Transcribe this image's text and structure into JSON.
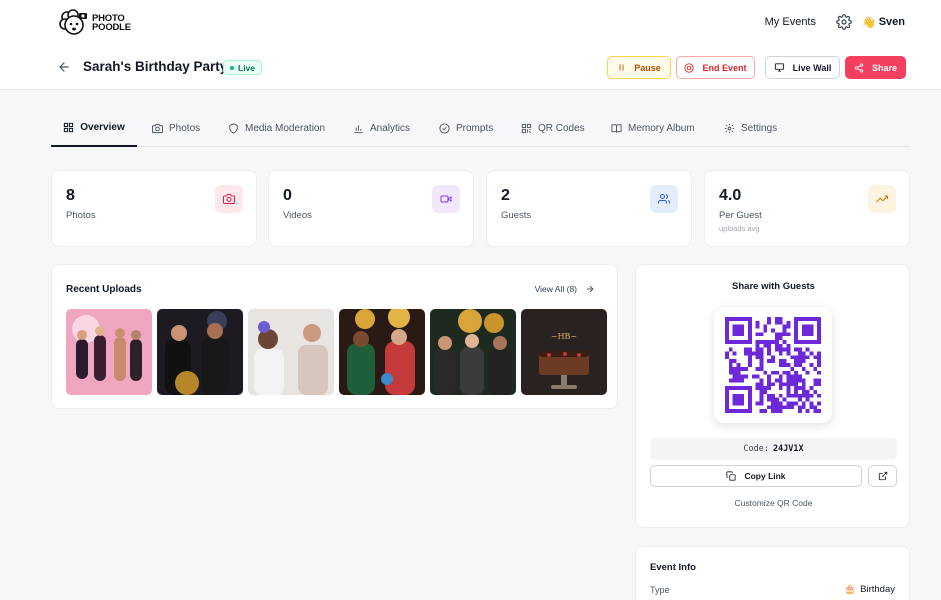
{
  "nav": {
    "logo_line1": "PHOTO",
    "logo_line2": "POODLE",
    "my_events": "My Events",
    "user_emoji": "👋",
    "user_name": "Sven"
  },
  "event": {
    "title": "Sarah's Birthday Party!",
    "status": "Live",
    "buttons": {
      "pause": "Pause",
      "end": "End Event",
      "live_wall": "Live Wall",
      "share": "Share"
    }
  },
  "tabs": [
    {
      "label": "Overview",
      "icon": "grid-icon",
      "active": true
    },
    {
      "label": "Photos",
      "icon": "camera-icon"
    },
    {
      "label": "Media Moderation",
      "icon": "shield-icon"
    },
    {
      "label": "Analytics",
      "icon": "bar-chart-icon"
    },
    {
      "label": "Prompts",
      "icon": "check-circle-icon"
    },
    {
      "label": "QR Codes",
      "icon": "qr-icon"
    },
    {
      "label": "Memory Album",
      "icon": "book-icon"
    },
    {
      "label": "Settings",
      "icon": "gear-icon"
    }
  ],
  "stats": [
    {
      "value": "8",
      "label": "Photos",
      "icon": "camera-icon",
      "color": "#e11d48",
      "bg": "#fde8ec"
    },
    {
      "value": "0",
      "label": "Videos",
      "icon": "video-icon",
      "color": "#7c3aed",
      "bg": "#f1e8fd"
    },
    {
      "value": "2",
      "label": "Guests",
      "icon": "users-icon",
      "color": "#2563eb",
      "bg": "#e5edfc"
    },
    {
      "value": "4.0",
      "label": "Per Guest",
      "sublabel": "uploads avg",
      "icon": "trending-up-icon",
      "color": "#d97706",
      "bg": "#fdf3e1"
    }
  ],
  "uploads": {
    "title": "Recent Uploads",
    "view_all": "View All (8)"
  },
  "share": {
    "title": "Share with Guests",
    "code_label": "Code:",
    "code_value": "24JV1X",
    "copy_link": "Copy Link",
    "customize": "Customize QR Code",
    "qr_color": "#6d28d9"
  },
  "info": {
    "title": "Event Info",
    "type_label": "Type",
    "type_emoji": "🎂",
    "type_value": "Birthday"
  }
}
